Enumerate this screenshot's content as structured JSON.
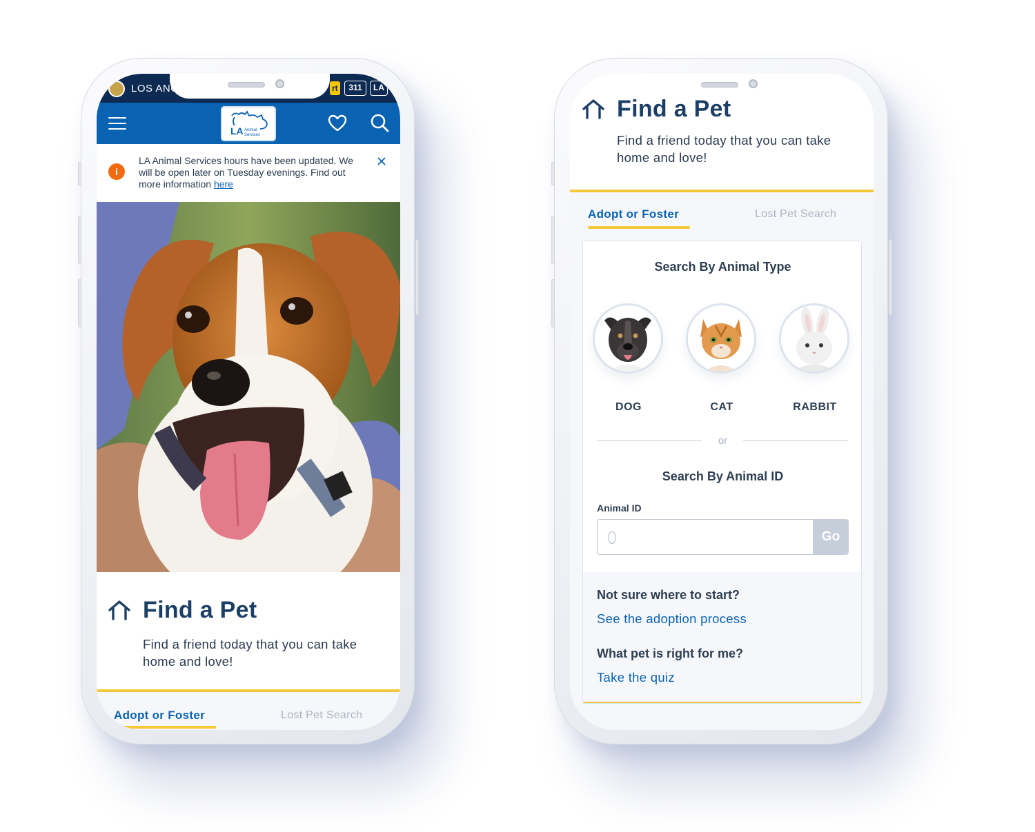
{
  "left_phone": {
    "city_bar": {
      "city_name": "LOS ANG",
      "alert_label": "rt",
      "chip_311": "311",
      "chip_la": "LA"
    },
    "header": {
      "logo_text": "LA",
      "logo_subtext": "Animal Services"
    },
    "notice": {
      "text": "LA Animal Services hours have been updated. We will be open later on Tuesday evenings. Find out more information ",
      "link": "here"
    },
    "find_pet": {
      "title": "Find a Pet",
      "subtitle": "Find a friend today that you can take home and love!"
    },
    "tabs": [
      "Adopt or Foster",
      "Lost Pet Search"
    ]
  },
  "right_phone": {
    "find_pet": {
      "title": "Find a Pet",
      "subtitle": "Find a friend today that you can take home and love!"
    },
    "tabs": [
      "Adopt or Foster",
      "Lost Pet Search"
    ],
    "search_by_type": {
      "heading": "Search By Animal Type",
      "animals": [
        {
          "label": "DOG",
          "icon": "dog-photo"
        },
        {
          "label": "CAT",
          "icon": "cat-photo"
        },
        {
          "label": "RABBIT",
          "icon": "rabbit-photo"
        }
      ]
    },
    "or_label": "or",
    "search_by_id": {
      "heading": "Search By Animal ID",
      "field_label": "Animal ID",
      "value": "",
      "button": "Go"
    },
    "help": [
      {
        "question": "Not sure where to start?",
        "link": "See the adoption process"
      },
      {
        "question": "What pet is right for me?",
        "link": "Take the quiz"
      }
    ]
  },
  "colors": {
    "navy": "#0d2a52",
    "brand_blue": "#0a62b3",
    "accent_yellow": "#f5c83a",
    "alert_orange": "#f26b0f"
  }
}
